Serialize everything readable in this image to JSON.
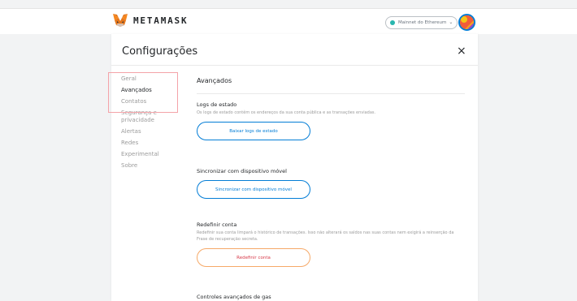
{
  "header": {
    "brand": "METAMASK",
    "network": "Mainnet do Ethereum",
    "network_dot_color": "#29b6af",
    "accent": "#037dd6"
  },
  "settings": {
    "title": "Configurações",
    "close_icon": "×",
    "nav": [
      {
        "label": "Geral"
      },
      {
        "label": "Avançados"
      },
      {
        "label": "Contatos"
      },
      {
        "label": "Segurança e privacidade"
      },
      {
        "label": "Alertas"
      },
      {
        "label": "Redes"
      },
      {
        "label": "Experimental"
      },
      {
        "label": "Sobre"
      }
    ],
    "active_nav": "Avançados"
  },
  "advanced": {
    "title": "Avançados",
    "state_logs": {
      "title": "Logs de estado",
      "description": "Os logs de estado contêm os endereços da sua conta pública e as transações enviadas.",
      "button": "Baixar logs de estado"
    },
    "sync": {
      "title": "Sincronizar com dispositivo móvel",
      "button": "Sincronizar com dispositivo móvel"
    },
    "reset": {
      "title": "Redefinir conta",
      "description": "Redefinir sua conta limpará o histórico de transações. Isso não alterará os saldos nas suas contas nem exigirá a reinserção da Frase de recuperação secreta.",
      "button": "Redefinir conta"
    },
    "gas": {
      "title": "Controles avançados de gas"
    }
  }
}
